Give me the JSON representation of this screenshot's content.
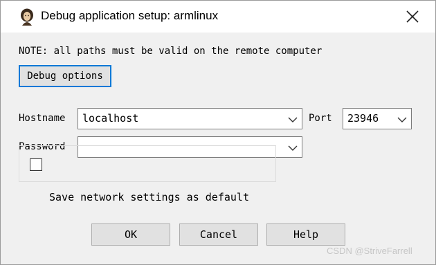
{
  "window": {
    "title": "Debug application setup: armlinux",
    "close_icon": "close-icon",
    "app_icon": "ida-portrait-icon"
  },
  "note": "NOTE: all paths must be valid on the remote computer",
  "debug_options_button": {
    "label": "Debug options"
  },
  "hostname": {
    "label": "Hostname",
    "value": "localhost"
  },
  "port": {
    "label": "Port",
    "value": "23946"
  },
  "password": {
    "label": "Password",
    "value": ""
  },
  "save_network_settings": {
    "label": "Save network settings as default",
    "checked": false
  },
  "buttons": {
    "ok": "OK",
    "cancel": "Cancel",
    "help": "Help"
  },
  "watermark": "CSDN @StriveFarrell",
  "colors": {
    "focus_border": "#0078d7",
    "dialog_bg": "#f0f0f0",
    "button_bg": "#e1e1e1"
  }
}
